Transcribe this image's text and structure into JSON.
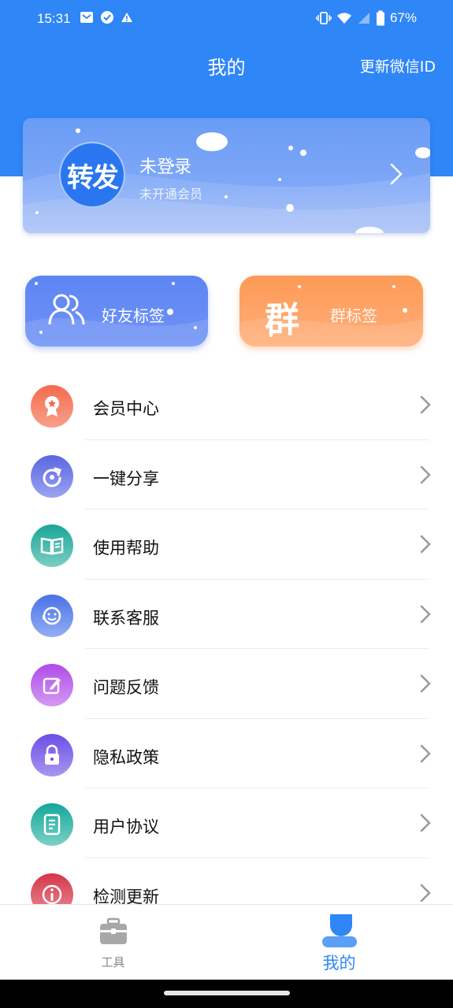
{
  "status_bar": {
    "time": "15:31",
    "battery": "67%",
    "left_icons": [
      "mail-icon",
      "check-badge-icon",
      "warning-icon"
    ],
    "right_icons": [
      "vibrate-icon",
      "wifi-icon",
      "signal-icon",
      "battery-icon"
    ]
  },
  "header": {
    "title": "我的",
    "action_label": "更新微信ID",
    "color": "#2f86f6"
  },
  "profile": {
    "avatar_text": "转发",
    "login_status": "未登录",
    "member_status": "未开通会员"
  },
  "tags": {
    "friend": {
      "label": "好友标签",
      "icon": "friends-icon",
      "color": "#5d85f3"
    },
    "group": {
      "label": "群标签",
      "glyph": "群",
      "color": "#fd9a57"
    }
  },
  "menu": [
    {
      "label": "会员中心",
      "icon": "member-badge-icon",
      "color": "#f46a4e"
    },
    {
      "label": "一键分享",
      "icon": "share-refresh-icon",
      "color": "#5b66e0"
    },
    {
      "label": "使用帮助",
      "icon": "help-book-icon",
      "color": "#19a596"
    },
    {
      "label": "联系客服",
      "icon": "customer-service-icon",
      "color": "#4a72e8"
    },
    {
      "label": "问题反馈",
      "icon": "feedback-edit-icon",
      "color": "#b04be8"
    },
    {
      "label": "隐私政策",
      "icon": "lock-icon",
      "color": "#6b4ee6"
    },
    {
      "label": "用户协议",
      "icon": "document-icon",
      "color": "#12a79a"
    },
    {
      "label": "检测更新",
      "icon": "info-icon",
      "color": "#d4374a"
    }
  ],
  "bottom_nav": {
    "tools_label": "工具",
    "mine_label": "我的",
    "active": "mine",
    "active_color": "#2f86f6"
  }
}
